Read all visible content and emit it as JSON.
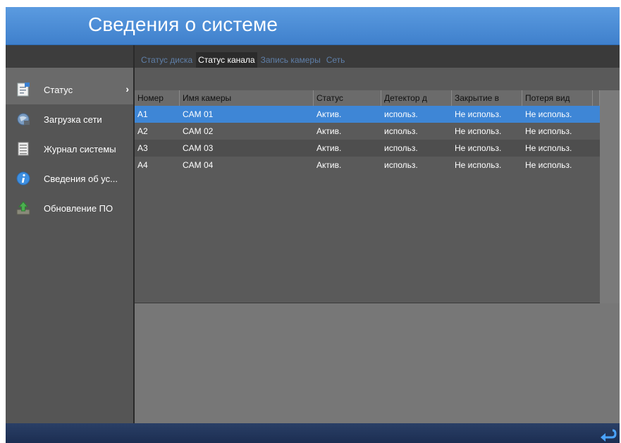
{
  "window": {
    "title": "Сведения о системе"
  },
  "sidebar": {
    "items": [
      {
        "label": "Статус",
        "icon": "document-icon",
        "active": true
      },
      {
        "label": "Загрузка сети",
        "icon": "network-globe-icon"
      },
      {
        "label": "Журнал системы",
        "icon": "log-list-icon"
      },
      {
        "label": "Сведения об ус...",
        "icon": "info-icon"
      },
      {
        "label": "Обновление ПО",
        "icon": "upgrade-arrow-icon"
      }
    ]
  },
  "tabs": [
    {
      "label": "Статус диска",
      "active": false
    },
    {
      "label": "Статус канала",
      "active": true
    },
    {
      "label": "Запись камеры",
      "active": false
    },
    {
      "label": "Сеть",
      "active": false
    }
  ],
  "table": {
    "columns": [
      "Номер",
      "Имя камеры",
      "Статус",
      "Детектор д",
      "Закрытие в",
      "Потеря вид"
    ],
    "rows": [
      [
        "A1",
        "CAM 01",
        "Актив.",
        "использ.",
        "Не использ.",
        "Не использ."
      ],
      [
        "A2",
        "CAM 02",
        "Актив.",
        "использ.",
        "Не использ.",
        "Не использ."
      ],
      [
        "A3",
        "CAM 03",
        "Актив.",
        "использ.",
        "Не использ.",
        "Не использ."
      ],
      [
        "A4",
        "CAM 04",
        "Актив.",
        "использ.",
        "Не использ.",
        "Не использ."
      ]
    ]
  },
  "colors": {
    "title_bar": "#4a8ad6",
    "selected_row": "#3e86d6",
    "footer": "#22375e"
  }
}
